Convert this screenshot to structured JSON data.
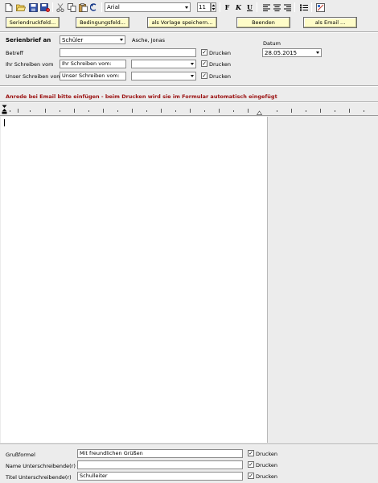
{
  "toolbar": {
    "font_name": "Arial",
    "font_size": "11",
    "bold_label": "F",
    "italic_label": "K",
    "underline_label": "U"
  },
  "buttons": {
    "seriendruckfeld": "Seriendruckfeld...",
    "bedingungsfeld": "Bedingungsfeld...",
    "vorlage_speichern": "als Vorlage speichern...",
    "beenden": "Beenden",
    "als_email": "als Email ..."
  },
  "form": {
    "serienbrief_label": "Serienbrief an",
    "recipient_select": "Schüler",
    "recipient_name": "Asche, Jonas",
    "datum_label": "Datum",
    "datum_value": "28.05.2015",
    "betreff_label": "Betreff",
    "betreff_value": "",
    "ihr_schreiben_label": "Ihr Schreiben vom",
    "ihr_schreiben_value": "Ihr Schreiben vom:",
    "ihr_schreiben_date": "",
    "unser_schreiben_label": "Unser Schreiben vom",
    "unser_schreiben_value": "Unser Schreiben vom:",
    "unser_schreiben_date": "",
    "drucken_label": "Drucken"
  },
  "note": "Anrede bei Email bitte einfügen - beim Drucken wird sie im Formular automatisch eingefügt",
  "footer": {
    "grussformel_label": "Grußformel",
    "grussformel_value": "Mit freundlichen Grüßen",
    "name_label": "Name Unterschreibende(r)",
    "name_value": "",
    "titel_label": "Titel Unterschreibende(r)",
    "titel_value": "Schulleiter",
    "drucken_label": "Drucken"
  },
  "checkbox_mark": "✓",
  "colors": {
    "button_yellow": "#fefcc8",
    "note_red": "#9a1010"
  }
}
